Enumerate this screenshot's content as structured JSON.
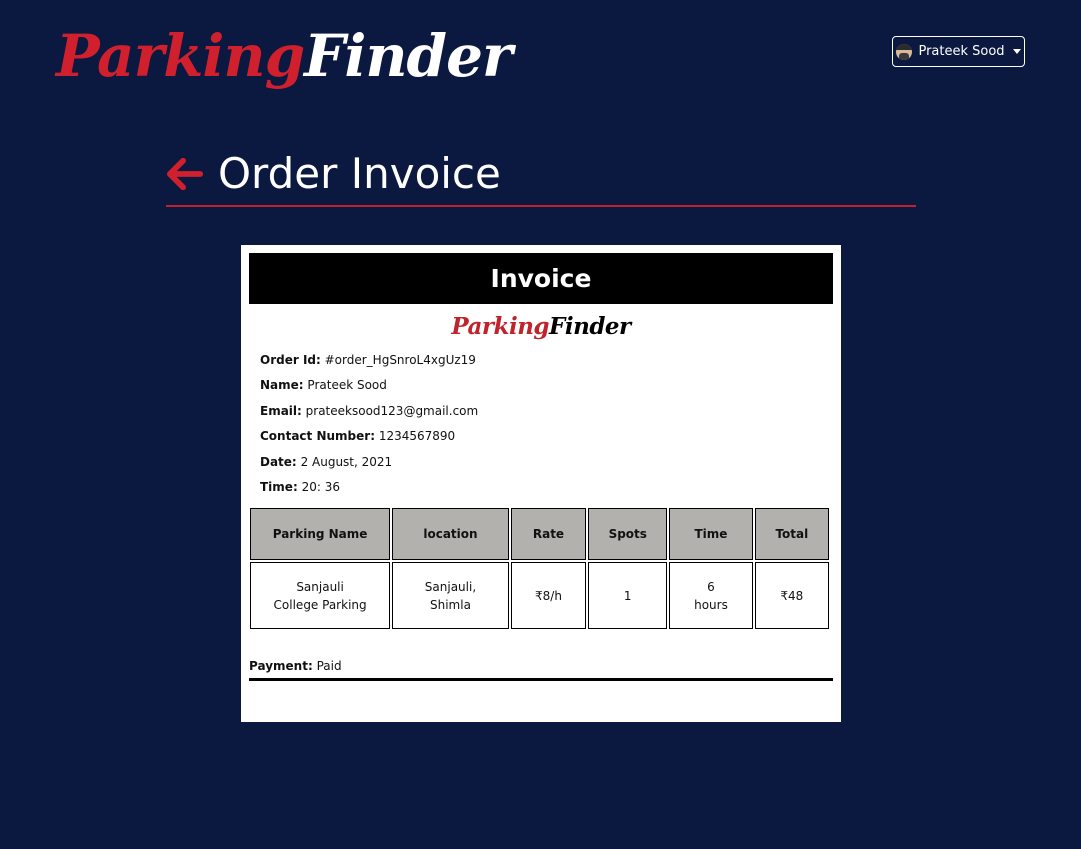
{
  "brand": {
    "part1": "Parking",
    "part2": "Finder"
  },
  "user": {
    "name": "Prateek Sood"
  },
  "page": {
    "title": "Order Invoice"
  },
  "invoice": {
    "heading": "Invoice",
    "brand": {
      "part1": "Parking",
      "part2": "Finder"
    },
    "fields": [
      {
        "label": "Order Id:",
        "value": "#order_HgSnroL4xgUz19"
      },
      {
        "label": "Name:",
        "value": "Prateek Sood"
      },
      {
        "label": "Email:",
        "value": "prateeksood123@gmail.com"
      },
      {
        "label": "Contact Number:",
        "value": "1234567890"
      },
      {
        "label": "Date:",
        "value": "2 August, 2021"
      },
      {
        "label": "Time:",
        "value": "20: 36"
      }
    ],
    "table": {
      "headers": [
        "Parking Name",
        "location",
        "Rate",
        "Spots",
        "Time",
        "Total"
      ],
      "row": {
        "parking_name_1": "Sanjauli",
        "parking_name_2": "College Parking",
        "location_1": "Sanjauli,",
        "location_2": "Shimla",
        "rate": "₹8/h",
        "spots": "1",
        "time_1": "6",
        "time_2": "hours",
        "total": "₹48"
      }
    },
    "payment": {
      "label": "Payment:",
      "value": "Paid"
    }
  },
  "colors": {
    "background": "#0b1840",
    "accent": "#d0202d",
    "header_cell": "#b3b1ae"
  }
}
